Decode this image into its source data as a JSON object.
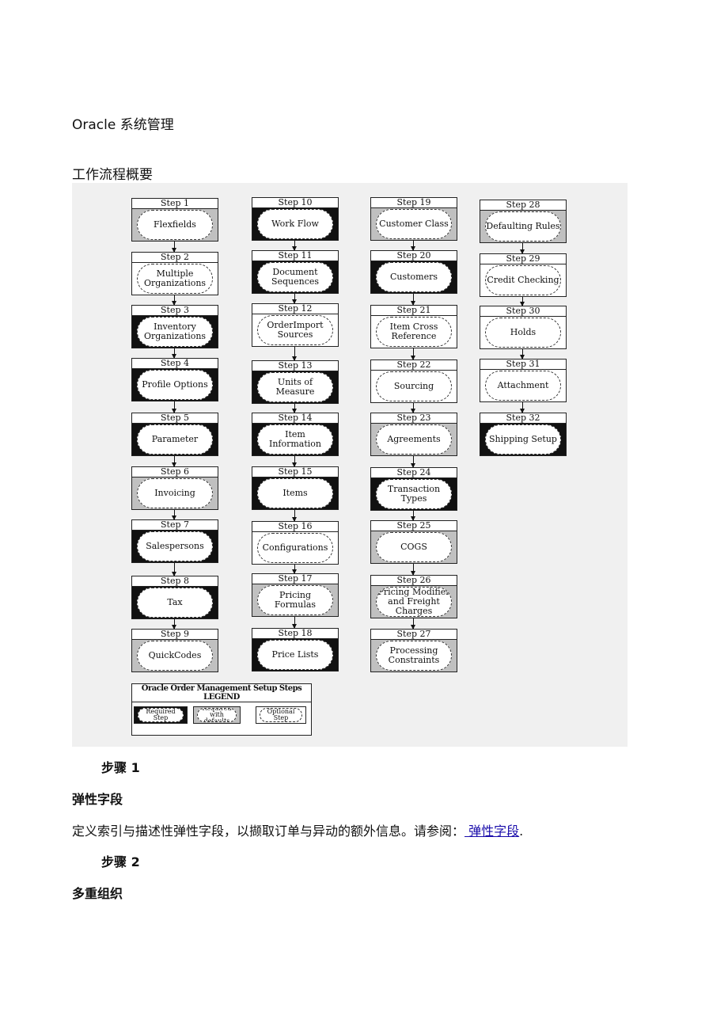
{
  "heading": {
    "title": "Oracle  系统管理",
    "subtitle": "工作流程概要"
  },
  "diagram": {
    "colors": {
      "required": "#111111",
      "required_with_defaults": "#c0c0c0",
      "optional": "#ffffff"
    },
    "columns": [
      [
        {
          "step": "Step 1",
          "label": "Flexfields",
          "type": "D"
        },
        {
          "step": "Step 2",
          "label": "Multiple Organizations",
          "type": "O"
        },
        {
          "step": "Step 3",
          "label": "Inventory Organizations",
          "type": "R"
        },
        {
          "step": "Step 4",
          "label": "Profile Options",
          "type": "R"
        },
        {
          "step": "Step 5",
          "label": "Parameter",
          "type": "R"
        },
        {
          "step": "Step 6",
          "label": "Invoicing",
          "type": "D"
        },
        {
          "step": "Step 7",
          "label": "Salespersons",
          "type": "R"
        },
        {
          "step": "Step 8",
          "label": "Tax",
          "type": "R"
        },
        {
          "step": "Step 9",
          "label": "QuickCodes",
          "type": "D"
        }
      ],
      [
        {
          "step": "Step 10",
          "label": "Work Flow",
          "type": "R"
        },
        {
          "step": "Step 11",
          "label": "Document Sequences",
          "type": "R"
        },
        {
          "step": "Step 12",
          "label": "OrderImport Sources",
          "type": "O"
        },
        {
          "step": "Step 13",
          "label": "Units of Measure",
          "type": "R"
        },
        {
          "step": "Step 14",
          "label": "Item Information",
          "type": "R"
        },
        {
          "step": "Step 15",
          "label": "Items",
          "type": "R"
        },
        {
          "step": "Step 16",
          "label": "Configurations",
          "type": "O"
        },
        {
          "step": "Step 17",
          "label": "Pricing Formulas",
          "type": "D"
        },
        {
          "step": "Step 18",
          "label": "Price Lists",
          "type": "R"
        }
      ],
      [
        {
          "step": "Step 19",
          "label": "Customer Class",
          "type": "D"
        },
        {
          "step": "Step 20",
          "label": "Customers",
          "type": "R"
        },
        {
          "step": "Step 21",
          "label": "Item Cross Reference",
          "type": "O"
        },
        {
          "step": "Step 22",
          "label": "Sourcing",
          "type": "O"
        },
        {
          "step": "Step 23",
          "label": "Agreements",
          "type": "D"
        },
        {
          "step": "Step 24",
          "label": "Transaction Types",
          "type": "R"
        },
        {
          "step": "Step 25",
          "label": "COGS",
          "type": "D"
        },
        {
          "step": "Step 26",
          "label": "Pricing Modifier and Freight Charges",
          "type": "D"
        },
        {
          "step": "Step 27",
          "label": "Processing Constraints",
          "type": "D"
        }
      ],
      [
        {
          "step": "Step 28",
          "label": "Defaulting Rules",
          "type": "D"
        },
        {
          "step": "Step 29",
          "label": "Credit Checking",
          "type": "O"
        },
        {
          "step": "Step 30",
          "label": "Holds",
          "type": "O"
        },
        {
          "step": "Step 31",
          "label": "Attachment",
          "type": "O"
        },
        {
          "step": "Step 32",
          "label": "Shipping Setup",
          "type": "R"
        }
      ]
    ],
    "legend": {
      "title": "Oracle Order Management Setup Steps LEGEND",
      "items": [
        {
          "label": "Required Step",
          "type": "R"
        },
        {
          "label": "Required with defaults",
          "type": "D"
        },
        {
          "label": "Optional Step",
          "type": "O"
        }
      ]
    }
  },
  "body": {
    "step1": "步骤  1",
    "step1_title": "弹性字段",
    "step1_text": "定义索引与描述性弹性字段，以撷取订单与异动的额外信息。请参阅：",
    "step1_link": " 弹性字段",
    "step1_end": ".",
    "step2": "步骤  2",
    "step2_title": "多重组织"
  }
}
